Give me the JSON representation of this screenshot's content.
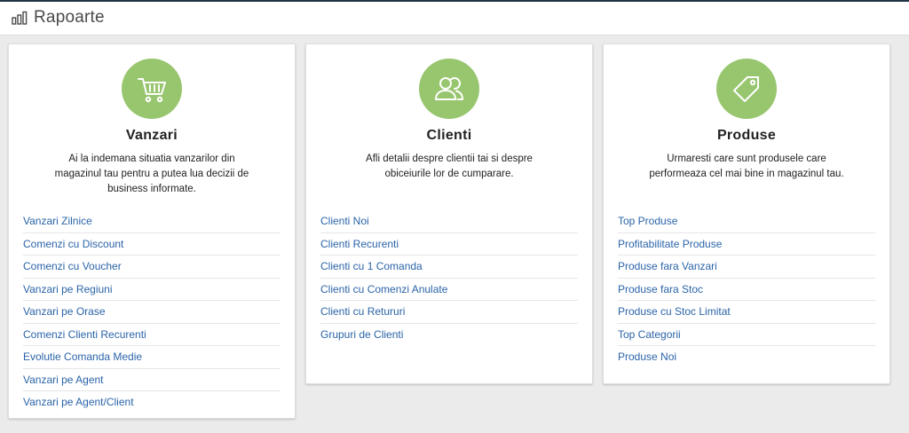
{
  "header": {
    "title": "Rapoarte",
    "icon": "bar-chart-icon"
  },
  "colors": {
    "accent_circle": "#98c66f",
    "link": "#2b64a8",
    "topbar_border": "#1f3344",
    "background": "#ebebeb"
  },
  "cards": [
    {
      "title": "Vanzari",
      "icon": "shopping-cart-icon",
      "description": "Ai la indemana situatia vanzarilor din magazinul tau pentru a putea lua decizii de business informate.",
      "links": [
        "Vanzari Zilnice",
        "Comenzi cu Discount",
        "Comenzi cu Voucher",
        "Vanzari pe Regiuni",
        "Vanzari pe Orase",
        "Comenzi Clienti Recurenti",
        "Evolutie Comanda Medie",
        "Vanzari pe Agent",
        "Vanzari pe Agent/Client"
      ]
    },
    {
      "title": "Clienti",
      "icon": "users-icon",
      "description": "Afli detalii despre clientii tai si despre obiceiurile lor de cumparare.",
      "links": [
        "Clienti Noi",
        "Clienti Recurenti",
        "Clienti cu 1 Comanda",
        "Clienti cu Comenzi Anulate",
        "Clienti cu Retururi",
        "Grupuri de Clienti"
      ]
    },
    {
      "title": "Produse",
      "icon": "tag-icon",
      "description": "Urmaresti care sunt produsele care performeaza cel mai bine in magazinul tau.",
      "links": [
        "Top Produse",
        "Profitabilitate Produse",
        "Produse fara Vanzari",
        "Produse fara Stoc",
        "Produse cu Stoc Limitat",
        "Top Categorii",
        "Produse Noi"
      ]
    }
  ]
}
